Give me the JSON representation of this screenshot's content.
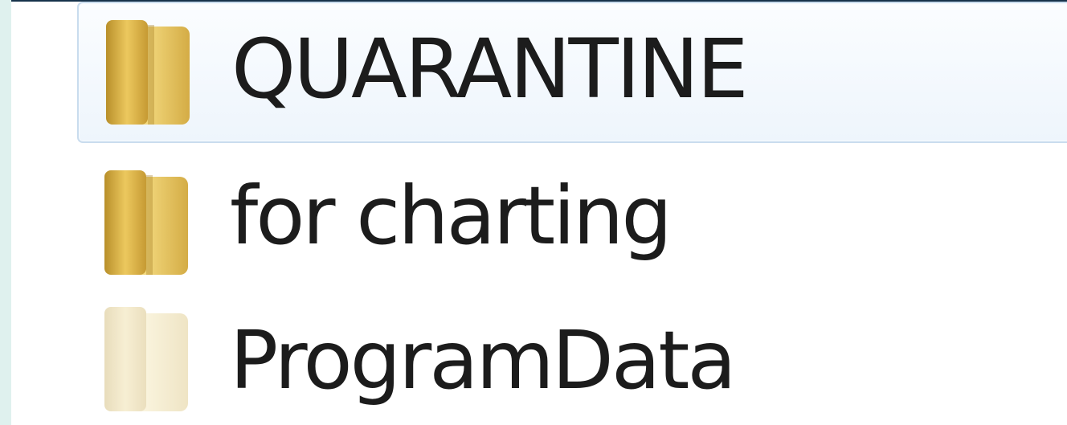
{
  "file_list": {
    "items": [
      {
        "name": "QUARANTINE",
        "icon": "folder-icon",
        "selected": true
      },
      {
        "name": "for charting",
        "icon": "folder-icon",
        "selected": false
      },
      {
        "name": "ProgramData",
        "icon": "folder-icon",
        "selected": false,
        "hidden": true
      }
    ]
  },
  "colors": {
    "selection_bg": "#eef5fc",
    "selection_border": "#c9dcee",
    "folder_yellow": "#e7c35a",
    "background_dark": "#1d3a4f",
    "left_strip": "#dff1ee"
  }
}
